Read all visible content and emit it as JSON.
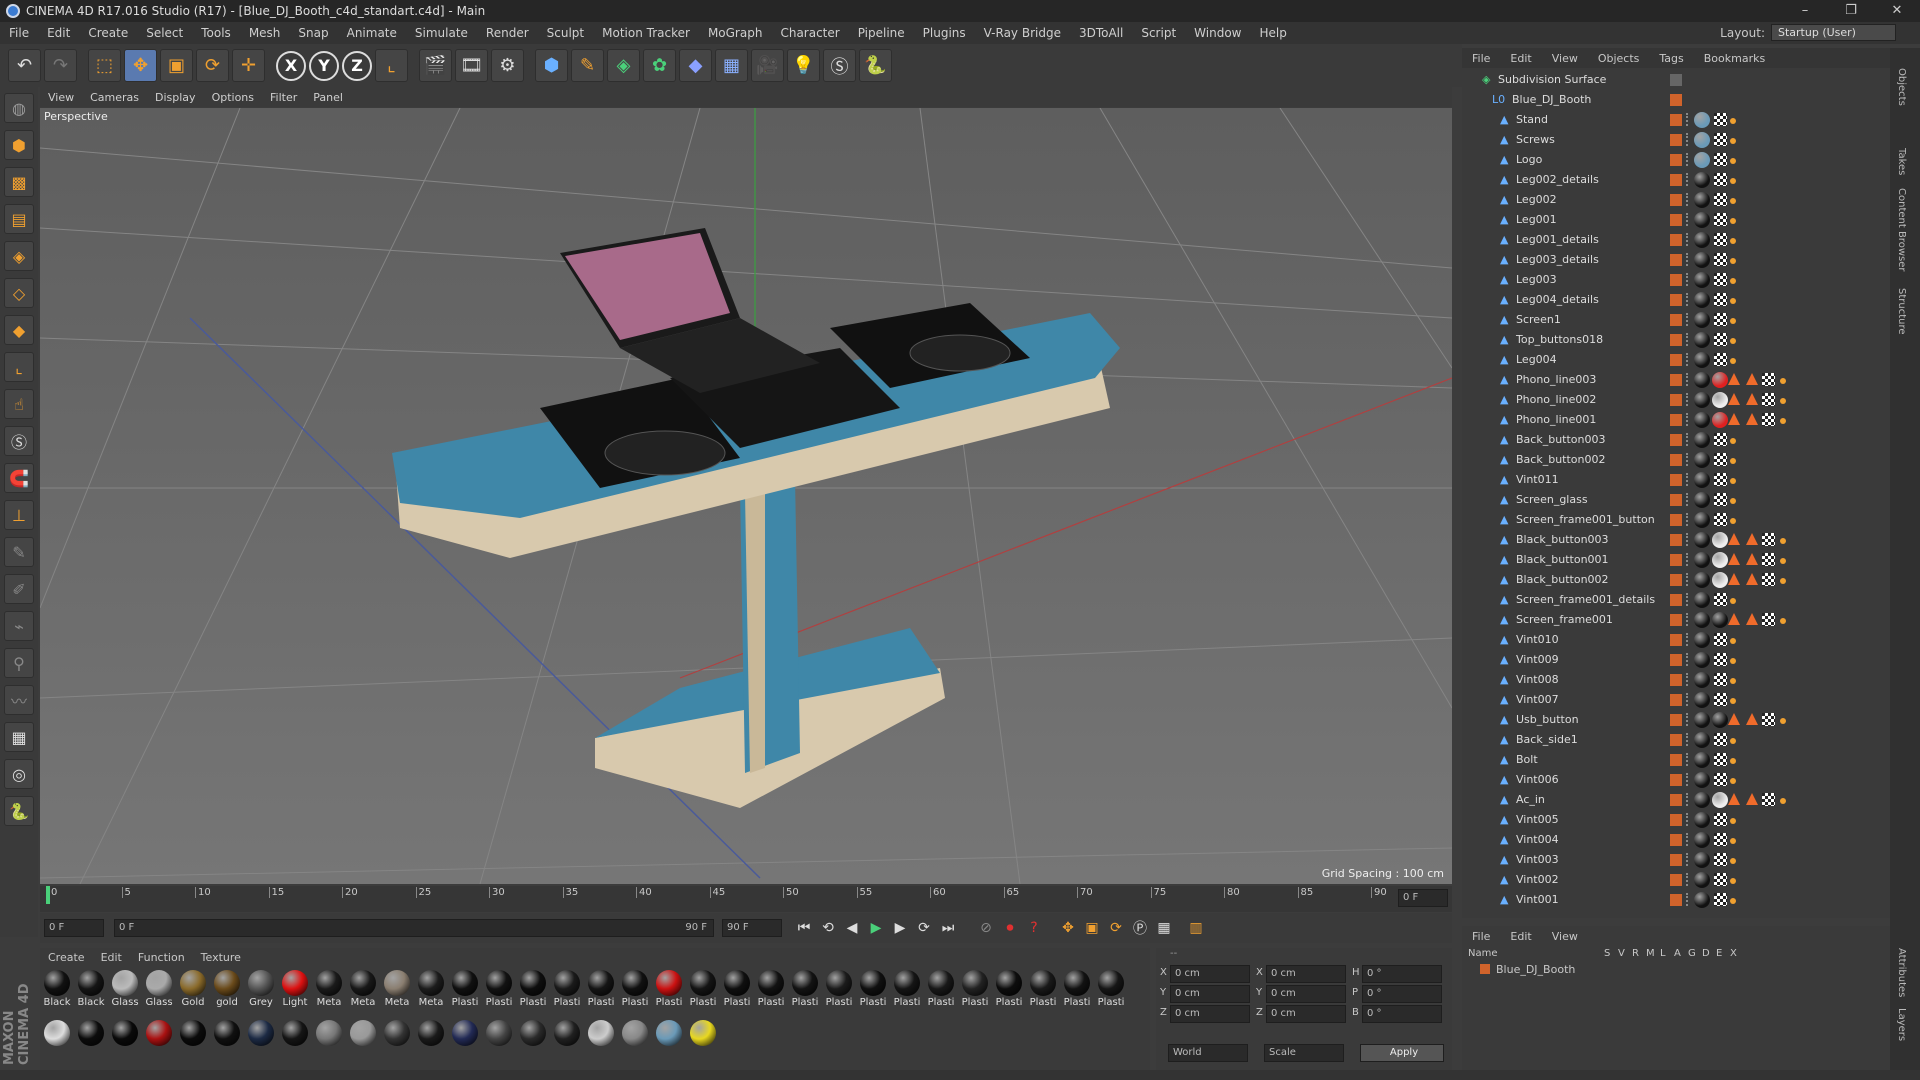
{
  "window": {
    "title": "CINEMA 4D R17.016 Studio (R17) - [Blue_DJ_Booth_c4d_standart.c4d] - Main",
    "controls": [
      "–",
      "❐",
      "✕"
    ]
  },
  "menu": [
    "File",
    "Edit",
    "Create",
    "Select",
    "Tools",
    "Mesh",
    "Snap",
    "Animate",
    "Simulate",
    "Render",
    "Sculpt",
    "Motion Tracker",
    "MoGraph",
    "Character",
    "Pipeline",
    "Plugins",
    "V-Ray Bridge",
    "3DToAll",
    "Script",
    "Window",
    "Help"
  ],
  "layout": {
    "label": "Layout:",
    "value": "Startup (User)"
  },
  "viewport": {
    "menu": [
      "View",
      "Cameras",
      "Display",
      "Options",
      "Filter",
      "Panel"
    ],
    "camera": "Perspective",
    "grid_spacing": "Grid Spacing : 100 cm"
  },
  "timeline": {
    "ticks": [
      "0",
      "5",
      "10",
      "15",
      "20",
      "25",
      "30",
      "35",
      "40",
      "45",
      "50",
      "55",
      "60",
      "65",
      "70",
      "75",
      "80",
      "85",
      "90"
    ],
    "end": "0 F"
  },
  "transport": {
    "start": "0 F",
    "range_start": "0 F",
    "range_end": "90 F",
    "end": "90 F"
  },
  "materials": {
    "menu": [
      "Create",
      "Edit",
      "Function",
      "Texture"
    ],
    "row1": [
      {
        "label": "Black",
        "color": "#111111"
      },
      {
        "label": "Black",
        "color": "#151515"
      },
      {
        "label": "Glass",
        "color": "#bbbbbb"
      },
      {
        "label": "Glass",
        "color": "#aaaaaa"
      },
      {
        "label": "Gold",
        "color": "#8a6a2a"
      },
      {
        "label": "gold",
        "color": "#6a4a1a"
      },
      {
        "label": "Grey",
        "color": "#555555"
      },
      {
        "label": "Light",
        "color": "#dd1111"
      },
      {
        "label": "Meta",
        "color": "#1a1a1a"
      },
      {
        "label": "Meta",
        "color": "#181818"
      },
      {
        "label": "Meta",
        "color": "#8a7e70"
      },
      {
        "label": "Meta",
        "color": "#1c1c1c"
      },
      {
        "label": "Plasti",
        "color": "#101010"
      },
      {
        "label": "Plasti",
        "color": "#121212"
      },
      {
        "label": "Plasti",
        "color": "#0e0e0e"
      },
      {
        "label": "Plasti",
        "color": "#1a1a1a"
      },
      {
        "label": "Plasti",
        "color": "#151515"
      },
      {
        "label": "Plasti",
        "color": "#111111"
      },
      {
        "label": "Plasti",
        "color": "#cc1111"
      },
      {
        "label": "Plasti",
        "color": "#141414"
      },
      {
        "label": "Plasti",
        "color": "#0f0f0f"
      },
      {
        "label": "Plasti",
        "color": "#121212"
      },
      {
        "label": "Plasti",
        "color": "#131313"
      },
      {
        "label": "Plasti",
        "color": "#1b1b1b"
      },
      {
        "label": "Plasti",
        "color": "#101010"
      },
      {
        "label": "Plasti",
        "color": "#151515"
      },
      {
        "label": "Plasti",
        "color": "#181818"
      },
      {
        "label": "Plasti",
        "color": "#222222"
      },
      {
        "label": "Plasti",
        "color": "#0d0d0d"
      },
      {
        "label": "Plasti",
        "color": "#191919"
      },
      {
        "label": "Plasti",
        "color": "#121212"
      },
      {
        "label": "Plasti",
        "color": "#161616"
      }
    ],
    "row2": [
      "#dddddd",
      "#0c0c0c",
      "#0a0a0a",
      "#aa1111",
      "#0b0b0b",
      "#101010",
      "#1c2a44",
      "#151515",
      "#777777",
      "#999999",
      "#333333",
      "#1a1a1a",
      "#222a55",
      "#444444",
      "#2a2a2a",
      "#202020",
      "#cccccc",
      "#888888",
      "#6a9ab8",
      "#e8d820"
    ]
  },
  "coords": {
    "rows": [
      {
        "a": "X",
        "av": "0 cm",
        "b": "X",
        "bv": "0 cm",
        "c": "H",
        "cv": "0 °"
      },
      {
        "a": "Y",
        "av": "0 cm",
        "b": "Y",
        "bv": "0 cm",
        "c": "P",
        "cv": "0 °"
      },
      {
        "a": "Z",
        "av": "0 cm",
        "b": "Z",
        "bv": "0 cm",
        "c": "B",
        "cv": "0 °"
      }
    ],
    "world": "World",
    "scale": "Scale",
    "apply": "Apply",
    "header": "--"
  },
  "objects": {
    "menu": [
      "File",
      "Edit",
      "View",
      "Objects",
      "Tags",
      "Bookmarks"
    ],
    "root": "Subdivision Surface",
    "group": "Blue_DJ_Booth",
    "items": [
      {
        "name": "Stand",
        "tags": "b"
      },
      {
        "name": "Screws",
        "tags": "b"
      },
      {
        "name": "Logo",
        "tags": "b"
      },
      {
        "name": "Leg002_details",
        "tags": "k"
      },
      {
        "name": "Leg002",
        "tags": "k"
      },
      {
        "name": "Leg001",
        "tags": "k"
      },
      {
        "name": "Leg001_details",
        "tags": "k"
      },
      {
        "name": "Leg003_details",
        "tags": "k"
      },
      {
        "name": "Leg003",
        "tags": "k"
      },
      {
        "name": "Leg004_details",
        "tags": "k"
      },
      {
        "name": "Screen1",
        "tags": "k"
      },
      {
        "name": "Top_buttons018",
        "tags": "g"
      },
      {
        "name": "Leg004",
        "tags": "k"
      },
      {
        "name": "Phono_line003",
        "tags": "r"
      },
      {
        "name": "Phono_line002",
        "tags": "w"
      },
      {
        "name": "Phono_line001",
        "tags": "r"
      },
      {
        "name": "Back_button003",
        "tags": "k"
      },
      {
        "name": "Back_button002",
        "tags": "g"
      },
      {
        "name": "Vint011",
        "tags": "k"
      },
      {
        "name": "Screen_glass",
        "tags": "s"
      },
      {
        "name": "Screen_frame001_button",
        "tags": "k"
      },
      {
        "name": "Black_button003",
        "tags": "w"
      },
      {
        "name": "Black_button001",
        "tags": "w"
      },
      {
        "name": "Black_button002",
        "tags": "w"
      },
      {
        "name": "Screen_frame001_details",
        "tags": "k"
      },
      {
        "name": "Screen_frame001",
        "tags": "x"
      },
      {
        "name": "Vint010",
        "tags": "k"
      },
      {
        "name": "Vint009",
        "tags": "k"
      },
      {
        "name": "Vint008",
        "tags": "k"
      },
      {
        "name": "Vint007",
        "tags": "k"
      },
      {
        "name": "Usb_button",
        "tags": "x"
      },
      {
        "name": "Back_side1",
        "tags": "k"
      },
      {
        "name": "Bolt",
        "tags": "k"
      },
      {
        "name": "Vint006",
        "tags": "k"
      },
      {
        "name": "Ac_in",
        "tags": "w"
      },
      {
        "name": "Vint005",
        "tags": "k"
      },
      {
        "name": "Vint004",
        "tags": "k"
      },
      {
        "name": "Vint003",
        "tags": "k"
      },
      {
        "name": "Vint002",
        "tags": "k"
      },
      {
        "name": "Vint001",
        "tags": "k"
      }
    ]
  },
  "attributes": {
    "menu": [
      "File",
      "Edit",
      "View"
    ],
    "cols": [
      "Name",
      "S",
      "V",
      "R",
      "M",
      "L",
      "A",
      "G",
      "D",
      "E",
      "X"
    ],
    "row": "Blue_DJ_Booth"
  },
  "side_tabs": [
    "Objects",
    "Takes",
    "Content Browser",
    "Structure",
    "Attributes",
    "Layers"
  ],
  "brand": "MAXON CINEMA 4D"
}
